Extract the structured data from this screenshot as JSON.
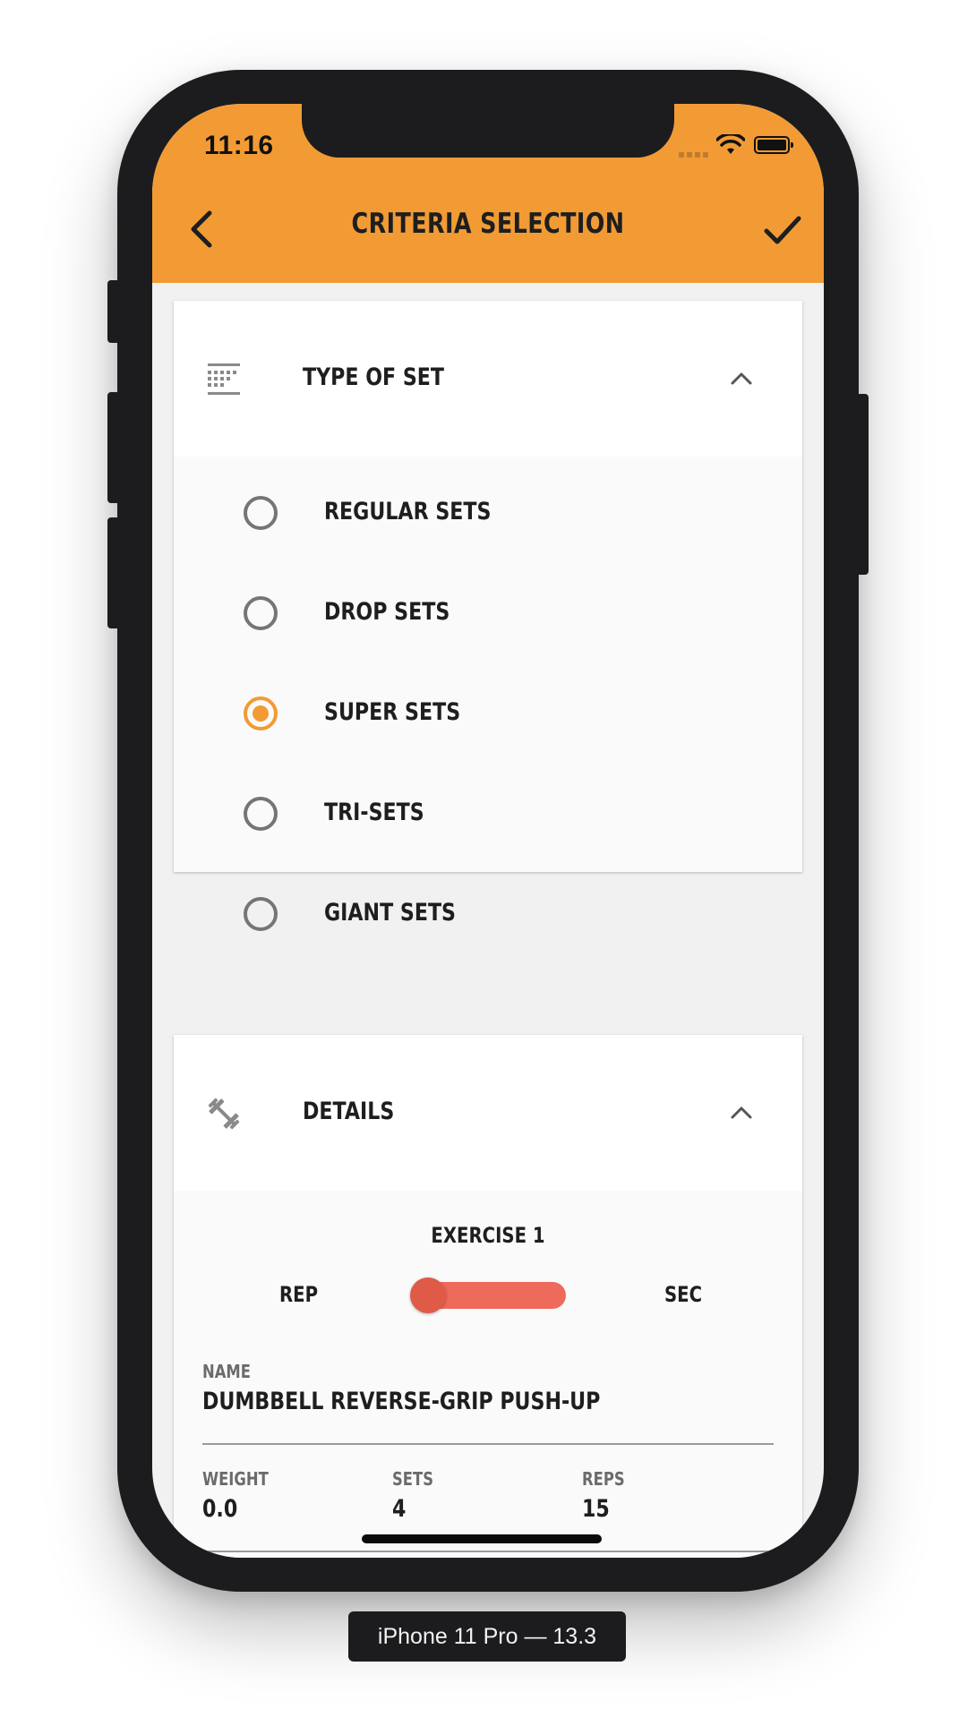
{
  "status_bar": {
    "time": "11:16"
  },
  "app_bar": {
    "title": "CRITERIA SELECTION",
    "accent_color": "#f29b35"
  },
  "type_of_set": {
    "title": "TYPE OF SET",
    "icon": "grid-list-icon",
    "expanded": true,
    "options": [
      {
        "label": "REGULAR SETS",
        "selected": false
      },
      {
        "label": "DROP SETS",
        "selected": false
      },
      {
        "label": "SUPER SETS",
        "selected": true
      },
      {
        "label": "TRI-SETS",
        "selected": false
      },
      {
        "label": "GIANT SETS",
        "selected": false
      }
    ]
  },
  "details": {
    "title": "DETAILS",
    "icon": "dumbbell-icon",
    "expanded": true,
    "exercise_title": "EXERCISE 1",
    "toggle": {
      "left_label": "REP",
      "right_label": "SEC",
      "value": "REP",
      "color": "#ee6a5a"
    },
    "name": {
      "label": "NAME",
      "value": "DUMBBELL REVERSE-GRIP PUSH-UP"
    },
    "weight": {
      "label": "WEIGHT",
      "value": "0.0"
    },
    "sets": {
      "label": "SETS",
      "value": "4"
    },
    "reps": {
      "label": "REPS",
      "value": "15"
    }
  },
  "device_label": "iPhone 11 Pro — 13.3"
}
